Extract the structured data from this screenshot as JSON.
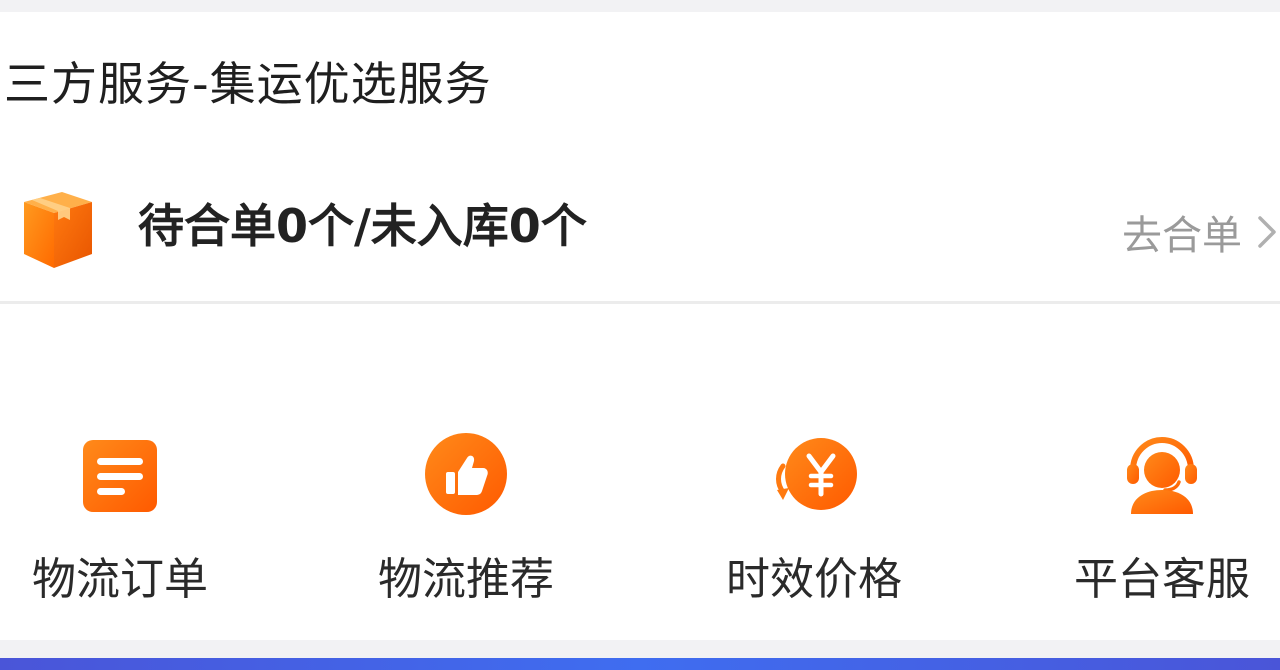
{
  "section": {
    "title": "三方服务-集运优选服务"
  },
  "status": {
    "icon": "package-box-icon",
    "text": "待合单0个/未入库0个",
    "link_label": "去合单",
    "link_icon": "chevron-right-icon"
  },
  "services": [
    {
      "label": "物流订单",
      "icon": "order-list-icon"
    },
    {
      "label": "物流推荐",
      "icon": "thumbs-up-icon"
    },
    {
      "label": "时效价格",
      "icon": "yuan-price-icon"
    },
    {
      "label": "平台客服",
      "icon": "customer-service-headset-icon"
    }
  ],
  "colors": {
    "accent_orange": "#ff6a00",
    "accent_orange_light": "#ff9a1f",
    "bottom_bar": "#4a55d8"
  }
}
